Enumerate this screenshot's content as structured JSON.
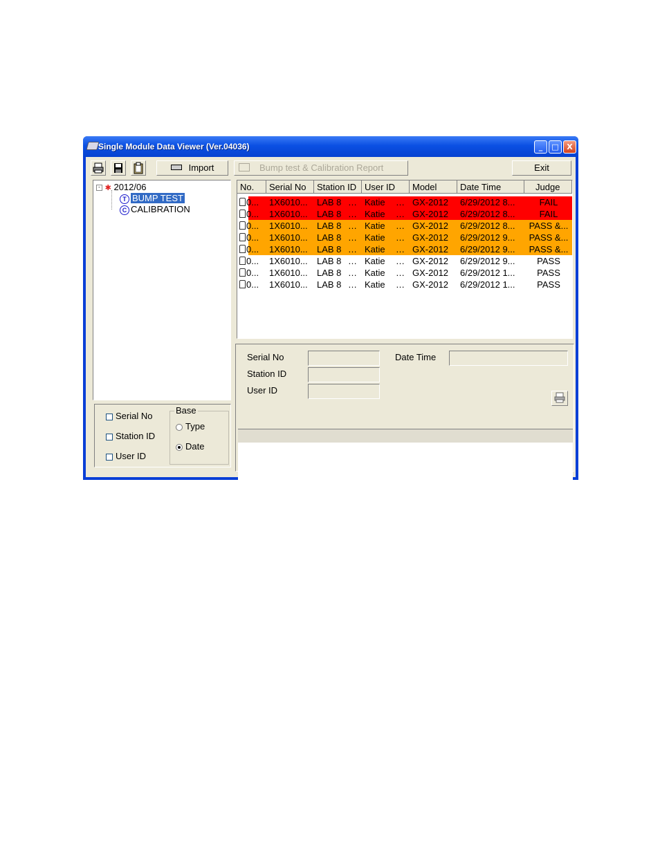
{
  "window": {
    "title": "Single Module Data Viewer (Ver.04036)",
    "controls": [
      "_",
      "□",
      "X"
    ]
  },
  "toolbar": {
    "icons": [
      "printer-icon",
      "save-icon",
      "clipboard-icon"
    ],
    "import_label": "Import",
    "report_label": "Bump test & Calibration Report",
    "exit_label": "Exit"
  },
  "tree": {
    "root": "2012/06",
    "items": [
      {
        "letter": "T",
        "label": "BUMP TEST",
        "selected": true
      },
      {
        "letter": "C",
        "label": "CALIBRATION",
        "selected": false
      }
    ]
  },
  "list": {
    "columns": [
      "No.",
      "Serial No",
      "Station ID",
      "User ID",
      "Model",
      "Date Time",
      "Judge"
    ],
    "rows": [
      {
        "no": "0...",
        "serial": "1X6010...",
        "station": "LAB 8",
        "user": "Katie",
        "model": "GX-2012",
        "datetime": "6/29/2012 8...",
        "judge": "FAIL",
        "color": "#ff0000"
      },
      {
        "no": "0...",
        "serial": "1X6010...",
        "station": "LAB 8",
        "user": "Katie",
        "model": "GX-2012",
        "datetime": "6/29/2012 8...",
        "judge": "FAIL",
        "color": "#ff0000"
      },
      {
        "no": "0...",
        "serial": "1X6010...",
        "station": "LAB 8",
        "user": "Katie",
        "model": "GX-2012",
        "datetime": "6/29/2012 8...",
        "judge": "PASS &...",
        "color": "#ffa500"
      },
      {
        "no": "0...",
        "serial": "1X6010...",
        "station": "LAB 8",
        "user": "Katie",
        "model": "GX-2012",
        "datetime": "6/29/2012 9...",
        "judge": "PASS &...",
        "color": "#ffa500"
      },
      {
        "no": "0...",
        "serial": "1X6010...",
        "station": "LAB 8",
        "user": "Katie",
        "model": "GX-2012",
        "datetime": "6/29/2012 9...",
        "judge": "PASS &...",
        "color": "#ffa500"
      },
      {
        "no": "0...",
        "serial": "1X6010...",
        "station": "LAB 8",
        "user": "Katie",
        "model": "GX-2012",
        "datetime": "6/29/2012 9...",
        "judge": "PASS",
        "color": "#ffffff"
      },
      {
        "no": "0...",
        "serial": "1X6010...",
        "station": "LAB 8",
        "user": "Katie",
        "model": "GX-2012",
        "datetime": "6/29/2012 1...",
        "judge": "PASS",
        "color": "#ffffff"
      },
      {
        "no": "0...",
        "serial": "1X6010...",
        "station": "LAB 8",
        "user": "Katie",
        "model": "GX-2012",
        "datetime": "6/29/2012 1...",
        "judge": "PASS",
        "color": "#ffffff"
      }
    ]
  },
  "detail": {
    "serial_label": "Serial No",
    "station_label": "Station ID",
    "user_label": "User ID",
    "datetime_label": "Date Time",
    "serial_value": "",
    "station_value": "",
    "user_value": "",
    "datetime_value": ""
  },
  "options": {
    "serial_label": "Serial No",
    "station_label": "Station ID",
    "user_label": "User ID",
    "base_label": "Base",
    "type_label": "Type",
    "date_label": "Date",
    "selected_base": "Date"
  }
}
